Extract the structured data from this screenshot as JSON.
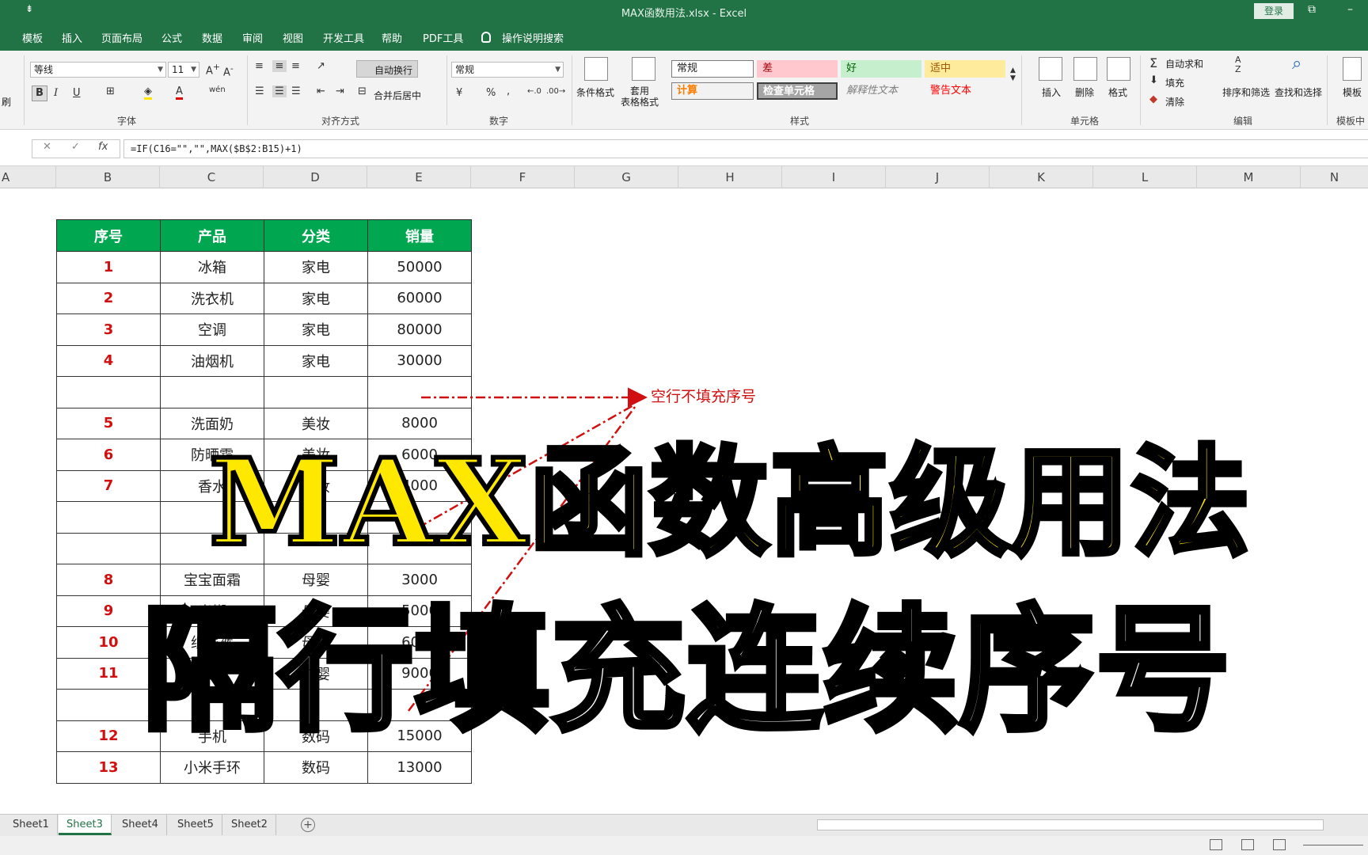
{
  "window": {
    "title": "MAX函数用法.xlsx  -  Excel",
    "login_label": "登录",
    "restore_glyph": "⧉",
    "qa_glyph": "⇟"
  },
  "menu": {
    "tabs": [
      "模板",
      "插入",
      "页面布局",
      "公式",
      "数据",
      "审阅",
      "视图",
      "开发工具",
      "帮助",
      "PDF工具",
      "操作说明搜索"
    ]
  },
  "ribbon": {
    "font_name": "等线",
    "font_size": "11",
    "font_group_label": "字体",
    "align_group_label": "对齐方式",
    "wrap_text_label": "自动换行",
    "merge_center_label": "合并后居中",
    "number_format": "常规",
    "number_group_label": "数字",
    "cond_format_label": "条件格式",
    "table_format_label": "套用\n表格格式",
    "styles_group_label": "样式",
    "styles": {
      "normal": "常规",
      "bad": "差",
      "good": "好",
      "neutral": "适中",
      "calc": "计算",
      "check": "检查单元格",
      "explain": "解释性文本",
      "warning": "警告文本"
    },
    "cells_group_label": "单元格",
    "insert_label": "插入",
    "delete_label": "删除",
    "format_label": "格式",
    "edit_group_label": "编辑",
    "autosum_label": "自动求和",
    "fill_label": "填充",
    "clear_label": "清除",
    "sort_filter_label": "排序和筛选",
    "find_select_label": "查找和选择",
    "template_label": "模板",
    "template_center_label": "模板中心",
    "brush_label": "刷",
    "bold": "B",
    "italic": "I",
    "underline": "U",
    "percent": "%",
    "comma": ","
  },
  "formula_bar": {
    "cancel": "✕",
    "enter": "✓",
    "fx": "fx",
    "formula": "=IF(C16=\"\",\"\",MAX($B$2:B15)+1)"
  },
  "columns": [
    "A",
    "B",
    "C",
    "D",
    "E",
    "F",
    "G",
    "H",
    "I",
    "J",
    "K",
    "L",
    "M",
    "N"
  ],
  "table": {
    "headers": [
      "序号",
      "产品",
      "分类",
      "销量"
    ],
    "rows": [
      [
        "1",
        "冰箱",
        "家电",
        "50000"
      ],
      [
        "2",
        "洗衣机",
        "家电",
        "60000"
      ],
      [
        "3",
        "空调",
        "家电",
        "80000"
      ],
      [
        "4",
        "油烟机",
        "家电",
        "30000"
      ],
      [
        "",
        "",
        "",
        ""
      ],
      [
        "5",
        "洗面奶",
        "美妆",
        "8000"
      ],
      [
        "6",
        "防晒霜",
        "美妆",
        "6000"
      ],
      [
        "7",
        "香水",
        "美妆",
        "4000"
      ],
      [
        "",
        "",
        "",
        ""
      ],
      [
        "",
        "",
        "",
        ""
      ],
      [
        "8",
        "宝宝面霜",
        "母婴",
        "3000"
      ],
      [
        "9",
        "米糊",
        "母婴",
        "5000"
      ],
      [
        "10",
        "纸尿裤",
        "母婴",
        "6000"
      ],
      [
        "11",
        "奶粉",
        "母婴",
        "9000"
      ],
      [
        "",
        "",
        "",
        ""
      ],
      [
        "12",
        "手机",
        "数码",
        "15000"
      ],
      [
        "13",
        "小米手环",
        "数码",
        "13000"
      ]
    ]
  },
  "annotation": {
    "text": "空行不填充序号",
    "color": "#d01010"
  },
  "overlay": {
    "line1": "MAX函数高级用法",
    "line2": "隔行填充连续序号",
    "line1_color": "#ffe800",
    "line2_color": "#ffffff"
  },
  "sheet_tabs": [
    "Sheet1",
    "Sheet3",
    "Sheet4",
    "Sheet5",
    "Sheet2"
  ],
  "active_sheet": "Sheet3",
  "add_sheet": "+",
  "colors": {
    "excel_green": "#217346",
    "header_green": "#00a650",
    "serial_red": "#d01010"
  }
}
